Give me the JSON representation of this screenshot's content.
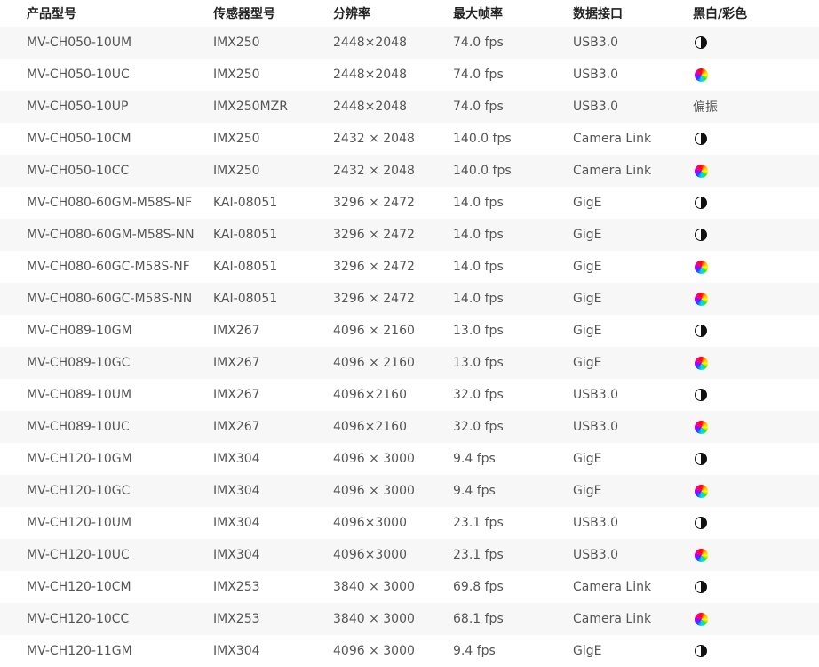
{
  "table": {
    "headers": [
      "产品型号",
      "传感器型号",
      "分辨率",
      "最大帧率",
      "数据接口",
      "黑白/彩色"
    ],
    "rows": [
      {
        "model": "MV-CH050-10UM",
        "sensor": "IMX250",
        "resolution": "2448×2048",
        "fps": "74.0 fps",
        "interface": "USB3.0",
        "color": {
          "type": "mono",
          "icon": "mono-icon"
        }
      },
      {
        "model": "MV-CH050-10UC",
        "sensor": "IMX250",
        "resolution": "2448×2048",
        "fps": "74.0 fps",
        "interface": "USB3.0",
        "color": {
          "type": "color",
          "icon": "color-icon"
        }
      },
      {
        "model": "MV-CH050-10UP",
        "sensor": "IMX250MZR",
        "resolution": "2448×2048",
        "fps": "74.0 fps",
        "interface": "USB3.0",
        "color": {
          "type": "text",
          "text": "偏振"
        }
      },
      {
        "model": "MV-CH050-10CM",
        "sensor": "IMX250",
        "resolution": "2432 × 2048",
        "fps": "140.0 fps",
        "interface": "Camera Link",
        "color": {
          "type": "mono",
          "icon": "mono-icon"
        }
      },
      {
        "model": "MV-CH050-10CC",
        "sensor": "IMX250",
        "resolution": "2432 × 2048",
        "fps": "140.0 fps",
        "interface": "Camera Link",
        "color": {
          "type": "color",
          "icon": "color-icon"
        }
      },
      {
        "model": "MV-CH080-60GM-M58S-NF",
        "sensor": "KAI-08051",
        "resolution": "3296 × 2472",
        "fps": "14.0 fps",
        "interface": "GigE",
        "color": {
          "type": "mono",
          "icon": "mono-icon"
        }
      },
      {
        "model": "MV-CH080-60GM-M58S-NN",
        "sensor": "KAI-08051",
        "resolution": "3296 × 2472",
        "fps": "14.0 fps",
        "interface": "GigE",
        "color": {
          "type": "mono",
          "icon": "mono-icon"
        }
      },
      {
        "model": "MV-CH080-60GC-M58S-NF",
        "sensor": "KAI-08051",
        "resolution": "3296 × 2472",
        "fps": "14.0 fps",
        "interface": "GigE",
        "color": {
          "type": "color",
          "icon": "color-icon"
        }
      },
      {
        "model": "MV-CH080-60GC-M58S-NN",
        "sensor": "KAI-08051",
        "resolution": "3296 × 2472",
        "fps": "14.0 fps",
        "interface": "GigE",
        "color": {
          "type": "color",
          "icon": "color-icon"
        }
      },
      {
        "model": "MV-CH089-10GM",
        "sensor": "IMX267",
        "resolution": "4096 × 2160",
        "fps": "13.0 fps",
        "interface": "GigE",
        "color": {
          "type": "mono",
          "icon": "mono-icon"
        }
      },
      {
        "model": "MV-CH089-10GC",
        "sensor": "IMX267",
        "resolution": "4096 × 2160",
        "fps": "13.0 fps",
        "interface": "GigE",
        "color": {
          "type": "color",
          "icon": "color-icon"
        }
      },
      {
        "model": "MV-CH089-10UM",
        "sensor": "IMX267",
        "resolution": "4096×2160",
        "fps": "32.0 fps",
        "interface": "USB3.0",
        "color": {
          "type": "mono",
          "icon": "mono-icon"
        }
      },
      {
        "model": "MV-CH089-10UC",
        "sensor": "IMX267",
        "resolution": "4096×2160",
        "fps": "32.0 fps",
        "interface": "USB3.0",
        "color": {
          "type": "color",
          "icon": "color-icon"
        }
      },
      {
        "model": "MV-CH120-10GM",
        "sensor": "IMX304",
        "resolution": "4096 × 3000",
        "fps": "9.4 fps",
        "interface": "GigE",
        "color": {
          "type": "mono",
          "icon": "mono-icon"
        }
      },
      {
        "model": "MV-CH120-10GC",
        "sensor": "IMX304",
        "resolution": "4096 × 3000",
        "fps": "9.4 fps",
        "interface": "GigE",
        "color": {
          "type": "color",
          "icon": "color-icon"
        }
      },
      {
        "model": "MV-CH120-10UM",
        "sensor": "IMX304",
        "resolution": "4096×3000",
        "fps": "23.1 fps",
        "interface": "USB3.0",
        "color": {
          "type": "mono",
          "icon": "mono-icon"
        }
      },
      {
        "model": "MV-CH120-10UC",
        "sensor": "IMX304",
        "resolution": "4096×3000",
        "fps": "23.1 fps",
        "interface": "USB3.0",
        "color": {
          "type": "color",
          "icon": "color-icon"
        }
      },
      {
        "model": "MV-CH120-10CM",
        "sensor": "IMX253",
        "resolution": "3840 × 3000",
        "fps": "69.8 fps",
        "interface": "Camera Link",
        "color": {
          "type": "mono",
          "icon": "mono-icon"
        }
      },
      {
        "model": "MV-CH120-10CC",
        "sensor": "IMX253",
        "resolution": "3840 × 3000",
        "fps": "68.1 fps",
        "interface": "Camera Link",
        "color": {
          "type": "color",
          "icon": "color-icon"
        }
      },
      {
        "model": "MV-CH120-11GM",
        "sensor": "IMX304",
        "resolution": "4096 × 3000",
        "fps": "9.4 fps",
        "interface": "GigE",
        "color": {
          "type": "mono",
          "icon": "mono-icon"
        }
      }
    ]
  },
  "colors": {
    "header_text": "#222222",
    "body_text": "#555555",
    "stripe": "#f7f7f7"
  }
}
